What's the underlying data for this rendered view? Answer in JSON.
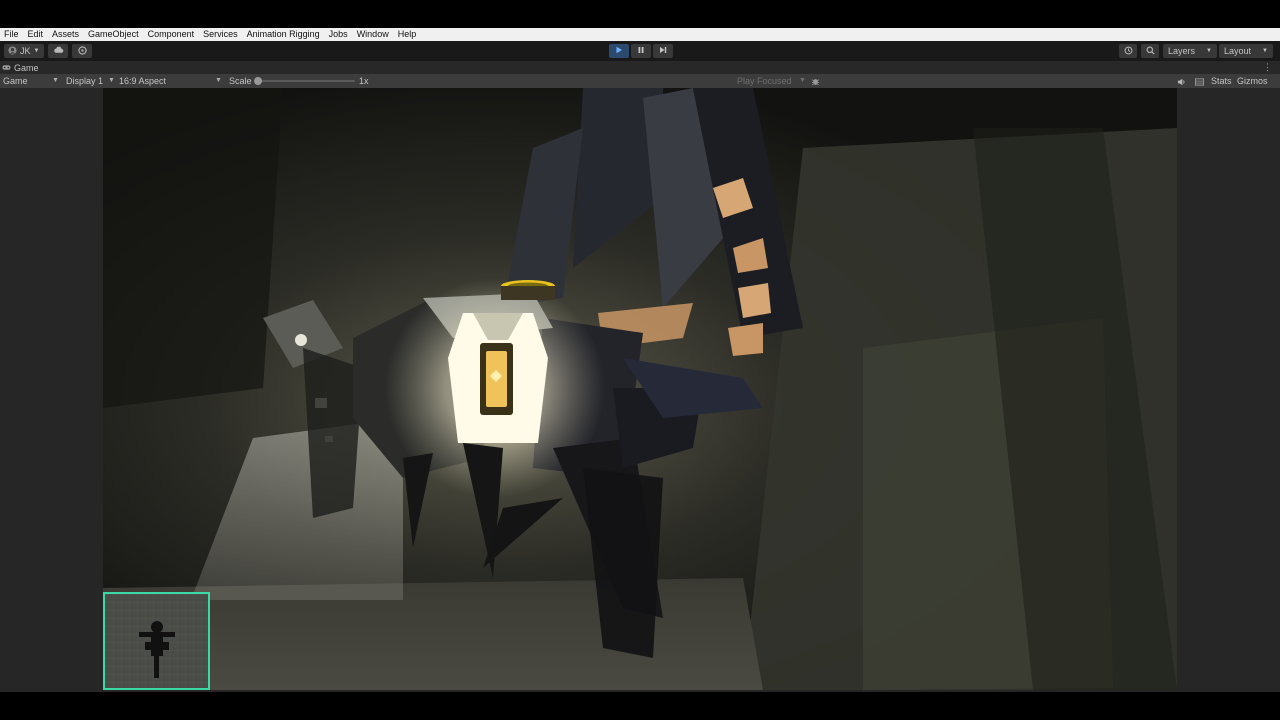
{
  "menu": {
    "items": [
      "File",
      "Edit",
      "Assets",
      "GameObject",
      "Component",
      "Services",
      "Animation Rigging",
      "Jobs",
      "Window",
      "Help"
    ]
  },
  "toolbar": {
    "account_label": "JK",
    "layers_label": "Layers",
    "layout_label": "Layout",
    "play_active": true
  },
  "tab": {
    "label": "Game"
  },
  "gamebar": {
    "mode": "Game",
    "display": "Display 1",
    "aspect": "16:9 Aspect",
    "scale_label": "Scale",
    "scale_value": "1x",
    "play_focused": "Play Focused",
    "stats": "Stats",
    "gizmos": "Gizmos"
  },
  "colors": {
    "accent_play": "#2b4a6e",
    "minimap_border": "#3ad9a5",
    "lamp_glow": "#fff6d6"
  },
  "icons": {
    "account": "account-icon",
    "cloud": "cloud-icon",
    "collab": "collab-icon",
    "play": "play-icon",
    "pause": "pause-icon",
    "step": "step-icon",
    "history": "history-icon",
    "search": "search-icon",
    "audio": "speaker-icon",
    "bug": "bug-icon"
  }
}
